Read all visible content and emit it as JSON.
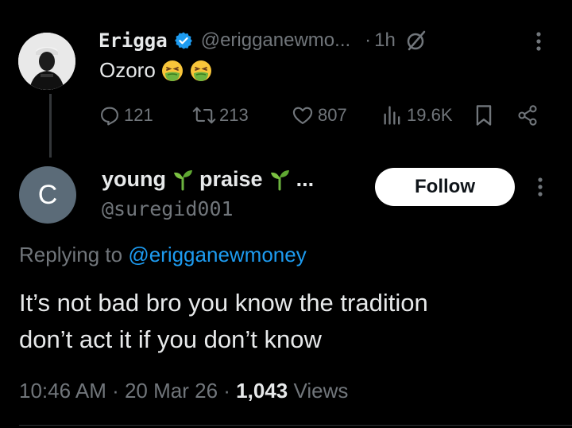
{
  "parent": {
    "name": "Erigga",
    "handle": "@erigganewmo...",
    "dot": "·",
    "time": "1h",
    "text": "Ozoro",
    "emoji_count": 2,
    "actions": {
      "replies": "121",
      "reposts": "213",
      "likes": "807",
      "views": "19.6K"
    }
  },
  "reply": {
    "avatar_initial": "C",
    "name_parts": [
      "young",
      "praise",
      "..."
    ],
    "handle": "@suregid001",
    "follow_label": "Follow",
    "replying_prefix": "Replying to ",
    "replying_handle": "@erigganewmoney",
    "text_lines": [
      "It’s not bad bro you know the tradition",
      "don’t act it if you don’t know"
    ],
    "meta": {
      "time": "10:46 AM",
      "sep1": " · ",
      "date": "20 Mar 26",
      "sep2": " · ",
      "views_count": "1,043",
      "views_label": " Views"
    }
  },
  "colors": {
    "background": "#000000",
    "primary_text": "#e7e9ea",
    "secondary_text": "#71767b",
    "link": "#1d9bf0",
    "verified": "#1d9bf0",
    "follow_bg": "#ffffff"
  }
}
